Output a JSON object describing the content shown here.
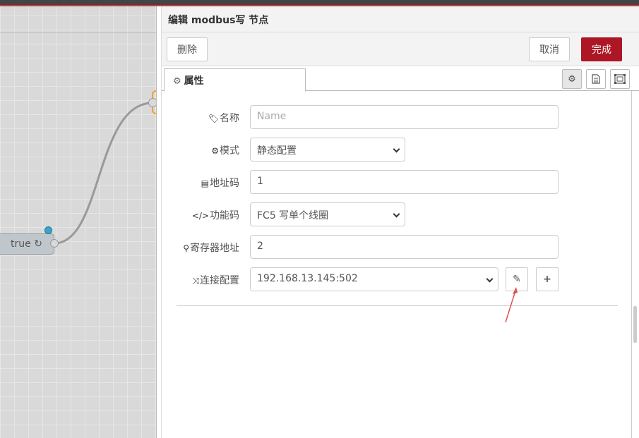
{
  "workspace": {
    "node_label": "true",
    "node_icon": "refresh-icon"
  },
  "tray": {
    "title": "编辑 modbus写 节点",
    "buttons": {
      "delete": "删除",
      "cancel": "取消",
      "done": "完成"
    },
    "tabs": {
      "properties": "属性"
    }
  },
  "form": {
    "name": {
      "label": "名称",
      "placeholder": "Name",
      "value": ""
    },
    "mode": {
      "label": "模式",
      "value": "静态配置"
    },
    "address_code": {
      "label": "地址码",
      "value": "1"
    },
    "function_code": {
      "label": "功能码",
      "value": "FC5 写单个线圈"
    },
    "register_address": {
      "label": "寄存器地址",
      "value": "2"
    },
    "connection": {
      "label": "连接配置",
      "value": "192.168.13.145:502"
    }
  },
  "colors": {
    "done_button": "#ad1625",
    "topbar": "#444444",
    "topbar_accent": "#cf3a3a",
    "status_dot": "#38a4c8",
    "annotation_arrow": "#e05050"
  }
}
